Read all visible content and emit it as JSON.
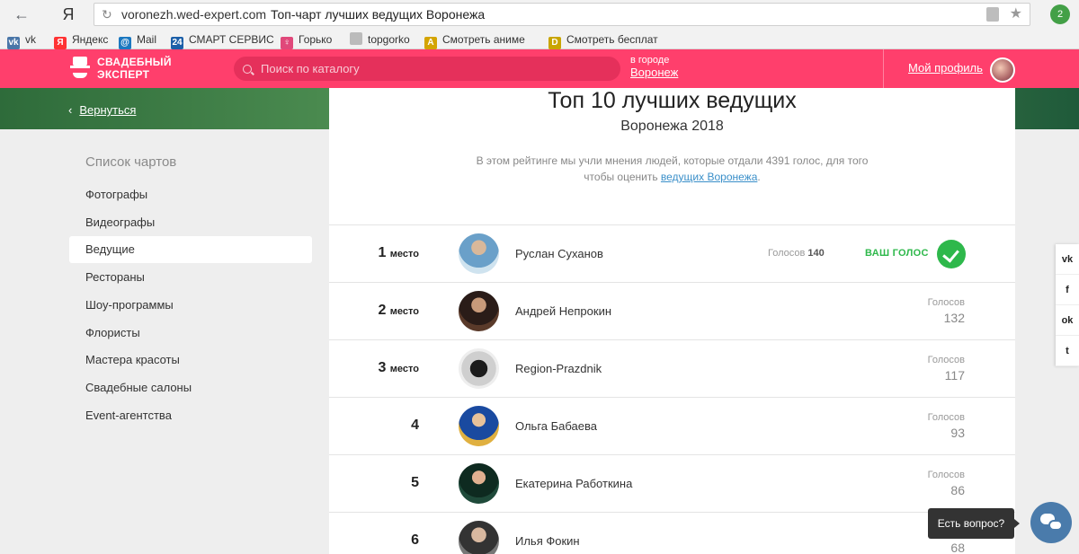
{
  "browser": {
    "back_icon": "←",
    "yandex_icon": "Я",
    "reload_icon": "↻",
    "url_domain": "voronezh.wed-expert.com",
    "page_title": "Топ-чарт лучших ведущих Воронежа",
    "star_icon": "★",
    "extension_badge": "2"
  },
  "bookmarks": [
    {
      "icon": "vk-icon",
      "glyph": "vk",
      "color": "#4a76a8",
      "label": "vk"
    },
    {
      "icon": "yandex-icon",
      "glyph": "Я",
      "color": "#f33",
      "label": "Яндекс"
    },
    {
      "icon": "mail-icon",
      "glyph": "@",
      "color": "#1c78c0",
      "label": "Mail"
    },
    {
      "icon": "tv24-icon",
      "glyph": "24",
      "color": "#1c5fa8",
      "label": "СМАРТ СЕРВИС"
    },
    {
      "icon": "gorko-icon",
      "glyph": "♀",
      "color": "#e0487a",
      "label": "Горько"
    },
    {
      "icon": "document-icon",
      "glyph": "",
      "color": "#bbb",
      "label": "topgorko"
    },
    {
      "icon": "anime-icon",
      "glyph": "A",
      "color": "#d4a400",
      "label": "Смотреть аниме"
    },
    {
      "icon": "film-icon",
      "glyph": "D",
      "color": "#c9a500",
      "label": "Смотреть бесплат"
    }
  ],
  "header": {
    "logo_line1": "СВАДЕБНЫЙ",
    "logo_line2": "ЭКСПЕРТ",
    "search_placeholder": "Поиск по каталогу",
    "city_label": "в городе",
    "city_value": "Воронеж",
    "profile_link": "Мой профиль"
  },
  "banner": {
    "back_label": "Вернуться",
    "back_icon": "‹"
  },
  "sidebar": {
    "title": "Список чартов",
    "items": [
      {
        "label": "Фотографы"
      },
      {
        "label": "Видеографы"
      },
      {
        "label": "Ведущие"
      },
      {
        "label": "Рестораны"
      },
      {
        "label": "Шоу-программы"
      },
      {
        "label": "Флористы"
      },
      {
        "label": "Мастера красоты"
      },
      {
        "label": "Свадебные салоны"
      },
      {
        "label": "Event-агентства"
      }
    ]
  },
  "chart": {
    "title": "Топ 10 лучших ведущих",
    "subtitle": "Воронежа 2018",
    "desc_before": "В этом рейтинге мы учли мнения людей, которые отдали 4391 голос, для того чтобы оценить ",
    "desc_link": "ведущих Воронежа",
    "desc_after": ".",
    "votes_label": "Голосов",
    "your_vote": "ВАШ ГОЛОС",
    "place_word": "место",
    "entries": [
      {
        "rank": "1",
        "name": "Руслан Суханов",
        "votes": "140"
      },
      {
        "rank": "2",
        "name": "Андрей Непрокин",
        "votes": "132"
      },
      {
        "rank": "3",
        "name": "Region-Prazdnik",
        "votes": "117"
      },
      {
        "rank": "4",
        "name": "Ольга Бабаева",
        "votes": "93"
      },
      {
        "rank": "5",
        "name": "Екатерина Работкина",
        "votes": "86"
      },
      {
        "rank": "6",
        "name": "Илья Фокин",
        "votes": "68"
      }
    ]
  },
  "social": [
    {
      "icon": "vk-icon",
      "glyph": "vk"
    },
    {
      "icon": "facebook-icon",
      "glyph": "f"
    },
    {
      "icon": "odnoklassniki-icon",
      "glyph": "ok"
    },
    {
      "icon": "twitter-icon",
      "glyph": "t"
    }
  ],
  "chat": {
    "tooltip": "Есть вопрос?"
  }
}
